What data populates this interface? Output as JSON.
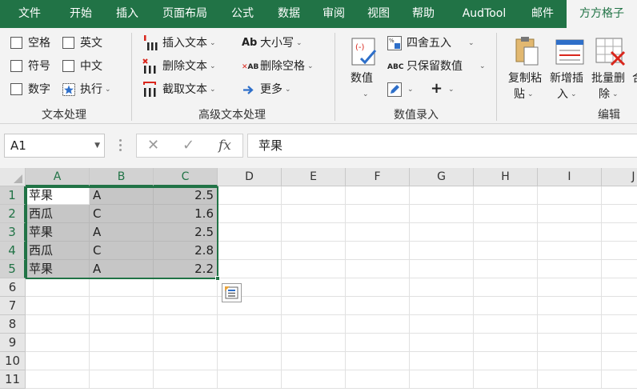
{
  "menu_tabs": [
    {
      "label": "文件"
    },
    {
      "label": "开始"
    },
    {
      "label": "插入"
    },
    {
      "label": "页面布局"
    },
    {
      "label": "公式"
    },
    {
      "label": "数据"
    },
    {
      "label": "审阅"
    },
    {
      "label": "视图"
    },
    {
      "label": "帮助"
    },
    {
      "label": "AudTool"
    },
    {
      "label": "邮件"
    },
    {
      "label": "方方格子"
    }
  ],
  "ribbon": {
    "text_processing": {
      "checkboxes": [
        {
          "label": "空格"
        },
        {
          "label": "英文"
        },
        {
          "label": "符号"
        },
        {
          "label": "中文"
        },
        {
          "label": "数字"
        }
      ],
      "execute_label": "执行",
      "title": "文本处理"
    },
    "advanced_text": {
      "insert_text": "插入文本",
      "delete_text": "删除文本",
      "cut_text": "截取文本",
      "case_label": "大小写",
      "delete_spaces": "删除空格",
      "more": "更多",
      "title": "高级文本处理",
      "icon_text_ab": "Ab",
      "icon_text_ab_small": "AB"
    },
    "numeric_entry": {
      "value_button": "数值",
      "round": "四舍五入",
      "keep_values": "只保留数值",
      "title": "数值录入",
      "icon_text_abc": "ABC"
    },
    "edit": {
      "copy_paste": "复制粘",
      "copy_paste_2": "贴",
      "add_insert": "新增插",
      "add_insert_2": "入",
      "batch_delete": "批量删",
      "batch_delete_2": "除",
      "title": "编辑",
      "cutoff_char": "合"
    }
  },
  "formula_bar": {
    "name_box": "A1",
    "formula": "苹果",
    "cancel_icon": "✕",
    "confirm_icon": "✓",
    "fx_label": "fx"
  },
  "grid": {
    "columns": [
      "A",
      "B",
      "C",
      "D",
      "E",
      "F",
      "G",
      "H",
      "I",
      "J"
    ],
    "rows": [
      "1",
      "2",
      "3",
      "4",
      "5",
      "6",
      "7",
      "8",
      "9",
      "10",
      "11"
    ],
    "data": [
      [
        "苹果",
        "A",
        "2.5"
      ],
      [
        "西瓜",
        "C",
        "1.6"
      ],
      [
        "苹果",
        "A",
        "2.5"
      ],
      [
        "西瓜",
        "C",
        "2.8"
      ],
      [
        "苹果",
        "A",
        "2.2"
      ]
    ]
  },
  "colors": {
    "excel_green": "#217346",
    "ribbon_bg": "#f3f3f3",
    "selection_fill": "#c6c6c6"
  }
}
